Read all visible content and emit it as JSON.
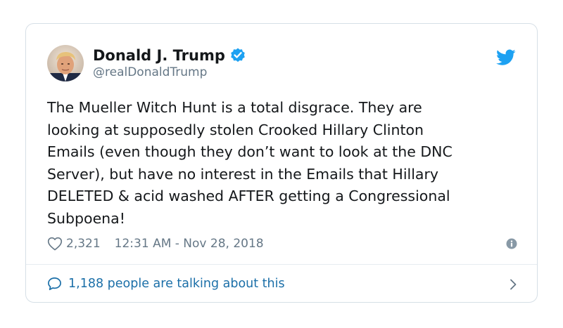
{
  "author": {
    "display_name": "Donald J. Trump",
    "handle": "@realDonaldTrump",
    "verified": true,
    "avatar_icon": "user-avatar"
  },
  "tweet": {
    "lines": [
      "The Mueller Witch Hunt is a total disgrace. They are",
      "looking at supposedly stolen Crooked Hillary Clinton",
      "Emails (even though they don’t want to look at the DNC",
      "Server), but have no interest in the Emails that Hillary",
      "DELETED & acid washed AFTER getting a Congressional",
      "Subpoena!"
    ]
  },
  "meta": {
    "like_count": "2,321",
    "timestamp": "12:31 AM - Nov 28, 2018"
  },
  "footer": {
    "talking_text": "1,188 people are talking about this"
  },
  "colors": {
    "brand": "#1da1f2",
    "link": "#1b6fa8",
    "text": "#14171a",
    "muted": "#657786",
    "border": "#d6dfe6"
  },
  "icons": [
    "twitter-bird-icon",
    "verified-badge-icon",
    "heart-icon",
    "info-icon",
    "reply-bubble-icon",
    "chevron-right-icon"
  ]
}
